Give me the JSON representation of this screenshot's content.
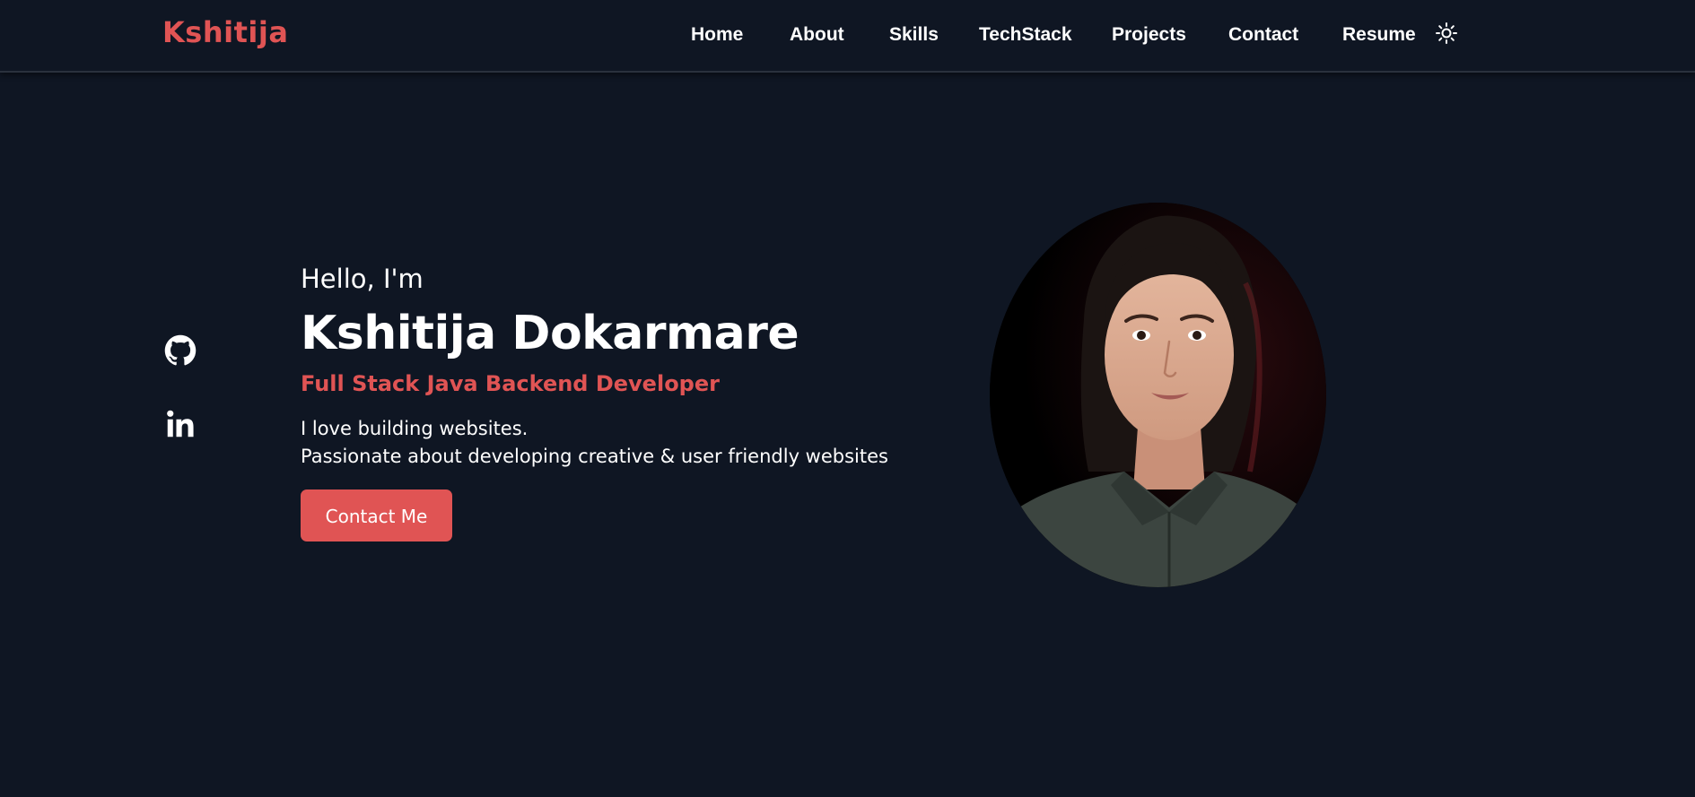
{
  "navbar": {
    "logo": "Kshitija",
    "links": [
      "Home",
      "About",
      "Skills",
      "TechStack",
      "Projects",
      "Contact",
      "Resume"
    ],
    "theme_toggle_icon": "sun-icon"
  },
  "social": {
    "github_icon": "github-icon",
    "linkedin_icon": "linkedin-icon"
  },
  "hero": {
    "greeting": "Hello, I'm",
    "name": "Kshitija Dokarmare",
    "role": "Full Stack Java Backend Developer",
    "description_line1": "I love building websites.",
    "description_line2": "Passionate about developing creative & user friendly websites",
    "cta_label": "Contact Me"
  },
  "colors": {
    "background": "#0f1623",
    "accent": "#e05454",
    "text": "#ffffff"
  }
}
